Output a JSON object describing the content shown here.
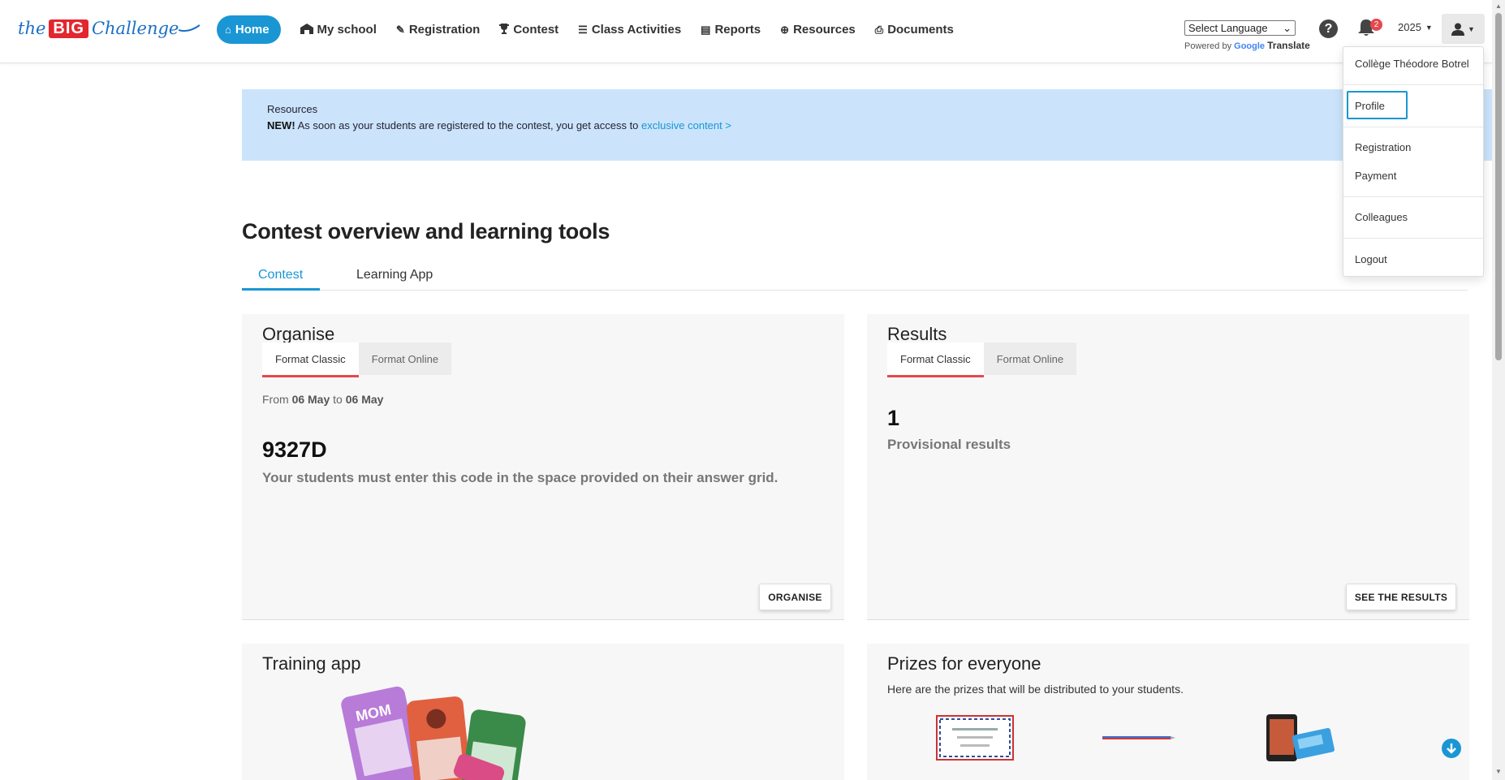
{
  "logo": {
    "the": "the",
    "big": "BIG",
    "challenge": "Challenge"
  },
  "nav": [
    {
      "label": "Home",
      "icon": "home-icon",
      "glyph": "⌂"
    },
    {
      "label": "My school",
      "icon": "school-icon",
      "glyph": "🏫"
    },
    {
      "label": "Registration",
      "icon": "edit-icon",
      "glyph": "✎"
    },
    {
      "label": "Contest",
      "icon": "trophy-icon",
      "glyph": "🏆"
    },
    {
      "label": "Class Activities",
      "icon": "list-icon",
      "glyph": "☰"
    },
    {
      "label": "Reports",
      "icon": "file-icon",
      "glyph": "▤"
    },
    {
      "label": "Resources",
      "icon": "globe-icon",
      "glyph": "⊕"
    },
    {
      "label": "Documents",
      "icon": "pdf-icon",
      "glyph": "⎙"
    }
  ],
  "language": {
    "selected": "Select Language",
    "powered_by": "Powered by",
    "google": "Google",
    "translate": "Translate"
  },
  "header": {
    "help": "?",
    "notifications": "2",
    "year": "2025"
  },
  "user_menu": {
    "school": "Collège Théodore Botrel",
    "profile": "Profile",
    "registration": "Registration",
    "payment": "Payment",
    "colleagues": "Colleagues",
    "logout": "Logout"
  },
  "banner": {
    "title": "Resources",
    "new": "NEW!",
    "text": " As soon as your students are registered to the contest, you get access to ",
    "link": "exclusive content >"
  },
  "page_title": "Contest overview and learning tools",
  "tabs": [
    "Contest",
    "Learning App"
  ],
  "organise": {
    "title": "Organise",
    "subtabs": [
      "Format Classic",
      "Format Online"
    ],
    "from": "From",
    "start": "06 May",
    "to": "to",
    "end": "06 May",
    "code": "9327D",
    "code_note": "Your students must enter this code in the space provided on their answer grid.",
    "button": "ORGANISE"
  },
  "results": {
    "title": "Results",
    "subtabs": [
      "Format Classic",
      "Format Online"
    ],
    "count": "1",
    "label": "Provisional results",
    "button": "SEE THE RESULTS"
  },
  "training": {
    "title": "Training app"
  },
  "prizes": {
    "title": "Prizes for everyone",
    "text": "Here are the prizes that will be distributed to your students."
  },
  "colors": {
    "accent": "#1a96d4",
    "banner": "#cbe4fb",
    "badge": "#e5484d"
  }
}
